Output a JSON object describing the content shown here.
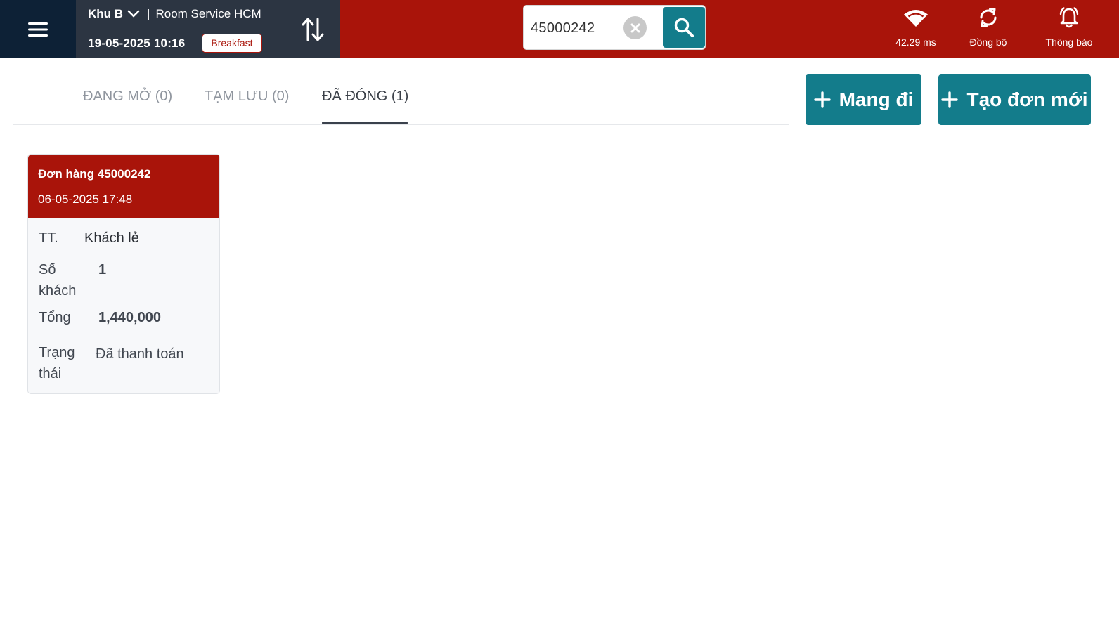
{
  "header": {
    "area": "Khu B",
    "separator": "|",
    "outlet": "Room Service HCM",
    "datetime": "19-05-2025 10:16",
    "meal_period": "Breakfast"
  },
  "search": {
    "value": "45000242"
  },
  "status": {
    "ping": "42.29 ms",
    "sync_label": "Đồng bộ",
    "notify_label": "Thông báo"
  },
  "tabs": [
    {
      "label": "ĐANG MỞ (0)",
      "active": false
    },
    {
      "label": "TẠM LƯU (0)",
      "active": false
    },
    {
      "label": "ĐÃ ĐÓNG (1)",
      "active": true
    }
  ],
  "actions": {
    "takeaway_label": "Mang đi",
    "new_order_label": "Tạo đơn mới"
  },
  "orders": [
    {
      "title": "Đơn hàng 45000242",
      "date": "06-05-2025 17:48",
      "fields": {
        "table_label": "TT.",
        "table_value": "Khách lẻ",
        "guests_label_1": "Số",
        "guests_label_2": "khách",
        "guests_value": "1",
        "total_label": "Tổng",
        "total_value": "1,440,000",
        "status_label_1": "Trạng",
        "status_label_2": "thái",
        "status_value": "Đã thanh toán"
      }
    }
  ],
  "colors": {
    "brand_red": "#a9140a",
    "navy": "#0d2136",
    "slate": "#2c3542",
    "teal": "#137c8b"
  },
  "icons": {
    "menu": "hamburger-icon",
    "dropdown": "chevron-down-icon",
    "swap": "swap-vertical-icon",
    "clear": "close-circle-icon",
    "search": "search-icon",
    "ping": "wifi-icon",
    "sync": "sync-icon",
    "notify": "bell-icon",
    "add": "plus-icon"
  }
}
